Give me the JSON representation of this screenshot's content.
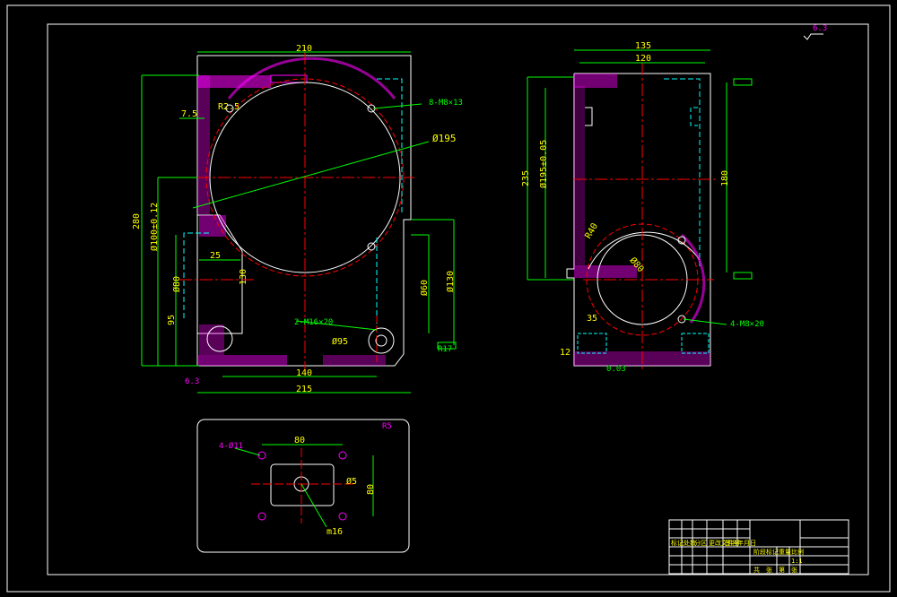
{
  "colors": {
    "background": "#000000",
    "outline": "#ffffff",
    "dimension": "#00ff00",
    "dimension_text": "#ffff00",
    "center_line": "#ff0000",
    "section": "#ff00ff",
    "hidden": "#00ffff",
    "leader": "#00ff00"
  },
  "front_view": {
    "dims": {
      "width_top": "210",
      "radius_r2": "R2.5",
      "offset": "7.5",
      "bolt_note": "8-M8×13",
      "bore": "Ø195",
      "height_total": "280",
      "height_center": "Ø100±0.12",
      "width_step": "25",
      "boss_width": "Ø80",
      "boss_depth": "130",
      "lower_height": "95",
      "small_dim": "R17",
      "tap_note": "2-M16×20",
      "bottom_dia": "Ø95",
      "inner_w": "140",
      "total_w": "215",
      "right_h1": "Ø60",
      "right_h2": "Ø130",
      "roughness": "6.3"
    }
  },
  "side_view": {
    "dims": {
      "width_outer": "135",
      "width_inner": "120",
      "height_left": "235",
      "height_mid": "Ø195±0.05",
      "height_right": "180",
      "bore_label": "Ø80",
      "angle_label": "R40",
      "bolt_note": "4-M8×20",
      "small_w": "35",
      "small_h": "12",
      "flat_label": "0.03"
    }
  },
  "bottom_view": {
    "dims": {
      "width": "80",
      "height": "80",
      "hole_note": "4-Ø11",
      "hole_dia": "Ø5",
      "center_dia": "m16",
      "radius_corner": "R5"
    }
  },
  "corner_note": "6.3",
  "title_block": {
    "rows": [
      "",
      "",
      "",
      ""
    ],
    "left_labels": [
      "标记",
      "处数",
      "分区",
      "更改文件号",
      "签名",
      "年月日"
    ],
    "mid_labels": [
      "阶段标记",
      "重量",
      "比例"
    ],
    "scale": "1:1",
    "sheet": [
      "共",
      "张",
      "第",
      "张"
    ]
  }
}
